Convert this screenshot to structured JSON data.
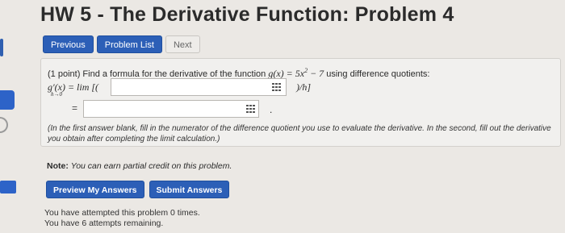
{
  "page": {
    "title": "HW 5 - The Derivative Function: Problem 4"
  },
  "nav": {
    "previous_label": "Previous",
    "problem_list_label": "Problem List",
    "next_label": "Next"
  },
  "problem": {
    "intro": "(1 point) Find a formula for the derivative of the function",
    "function_math": "g(x) = 5x",
    "exponent": "2",
    "function_tail": " − 7",
    "intro_end": "using difference quotients:",
    "derivative_lhs": "g′(x) = lim [(",
    "limit_sub": "h→0",
    "after_first_blank": ")/h]",
    "equals": "=",
    "answer1": "",
    "answer2": "",
    "instructions": "(In the first answer blank, fill in the numerator of the difference quotient you use to evaluate the derivative. In the second, fill out the derivative you obtain after completing the limit calculation.)"
  },
  "note": {
    "label": "Note:",
    "text": "You can earn partial credit on this problem."
  },
  "actions": {
    "preview_label": "Preview My Answers",
    "submit_label": "Submit Answers"
  },
  "status": {
    "attempted": "You have attempted this problem 0 times.",
    "remaining": "You have 6 attempts remaining."
  },
  "colors": {
    "accent": "#2c5fb7",
    "background": "#ebe8e4"
  },
  "icons": {
    "equation_editor": "grid-icon"
  }
}
